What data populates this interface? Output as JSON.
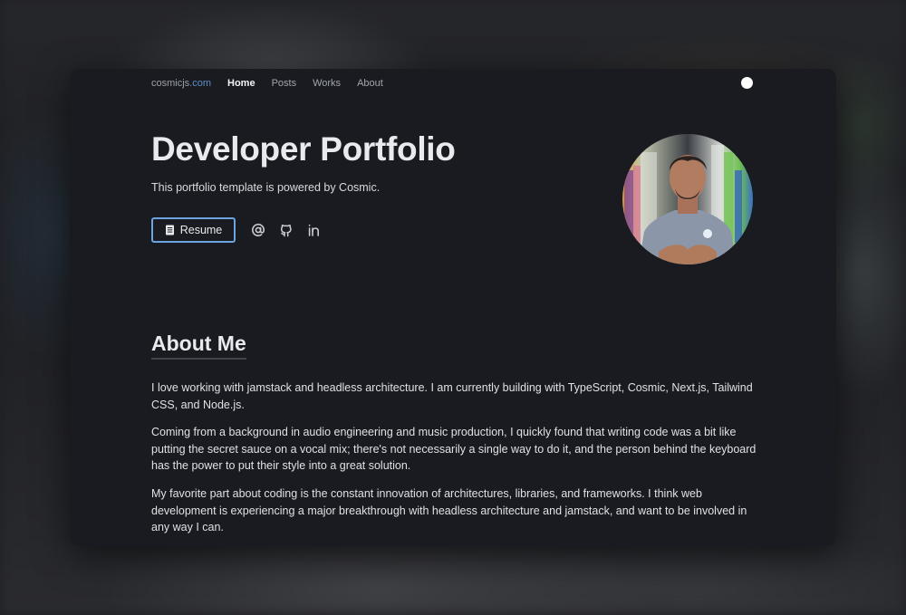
{
  "nav": {
    "brand_name": "cosmicjs",
    "brand_tld": ".com",
    "links": [
      {
        "label": "Home",
        "active": true
      },
      {
        "label": "Posts",
        "active": false
      },
      {
        "label": "Works",
        "active": false
      },
      {
        "label": "About",
        "active": false
      }
    ],
    "theme_toggle_icon": "circle-toggle-icon"
  },
  "hero": {
    "title": "Developer Portfolio",
    "subtitle": "This portfolio template is powered by Cosmic.",
    "resume_button": {
      "label": "Resume",
      "icon": "document-icon"
    },
    "social_icons": [
      "at-sign-icon",
      "github-icon",
      "linkedin-icon"
    ],
    "avatar_alt": "Portrait of developer in grey t-shirt with arms crossed in front of surfboards"
  },
  "about": {
    "heading": "About Me",
    "paragraphs": [
      "I love working with jamstack and headless architecture. I am currently building with TypeScript, Cosmic, Next.js, Tailwind CSS, and Node.js.",
      "Coming from a background in audio engineering and music production, I quickly found that writing code was a bit like putting the secret sauce on a vocal mix; there's not necessarily a single way to do it, and the person behind the keyboard has the power to put their style into a great solution.",
      "My favorite part about coding is the constant innovation of architectures, libraries, and frameworks. I think web development is experiencing a major breakthrough with headless architecture and jamstack, and want to be involved in any way I can."
    ]
  },
  "colors": {
    "accent": "#6aa5e0",
    "brand_tld": "#5b8fc9",
    "window_bg": "#1a1b20",
    "text": "#e8eaee"
  }
}
